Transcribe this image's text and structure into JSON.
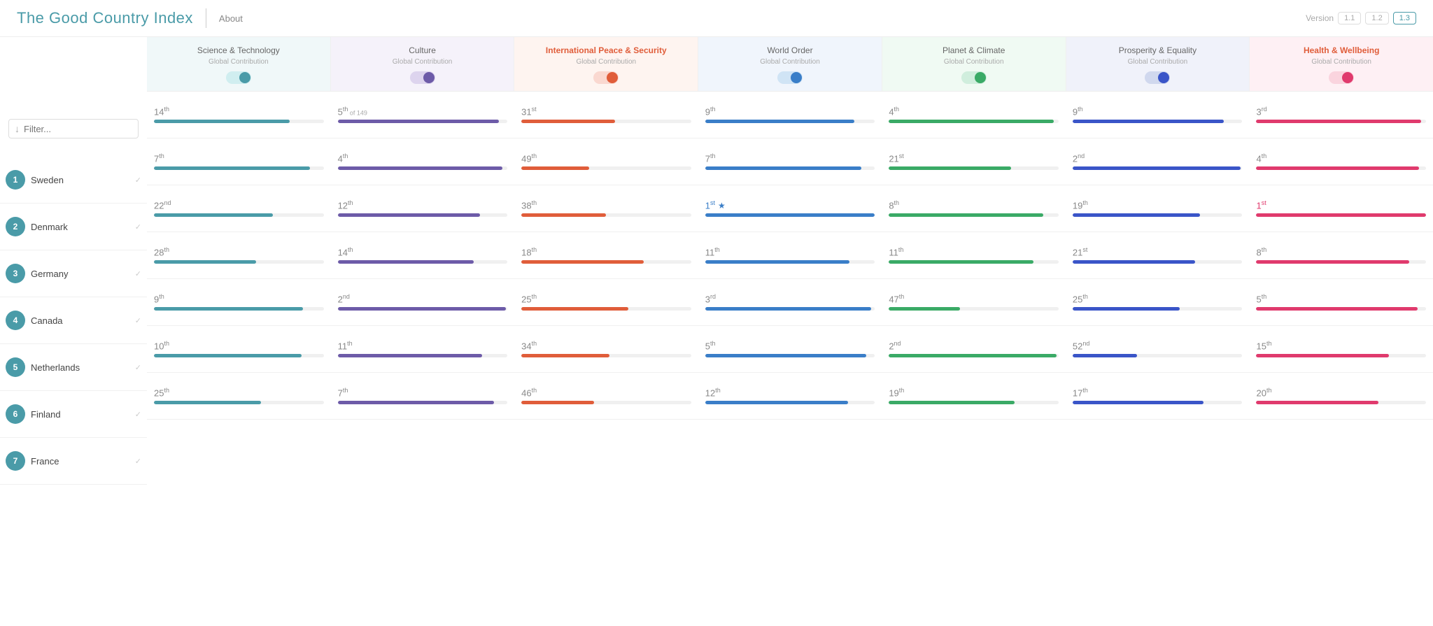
{
  "header": {
    "title": "The Good Country Index",
    "about_label": "About",
    "version_label": "Version",
    "versions": [
      "1.1",
      "1.2",
      "1.3"
    ]
  },
  "filter": {
    "placeholder": "Filter..."
  },
  "columns": [
    {
      "id": "sci_tech",
      "title": "Science & Technology",
      "subtitle": "Global Contribution",
      "highlighted": false,
      "toggle_color": "teal",
      "bg": "col-bg-teal",
      "bar_color": "bar-teal",
      "toggle_state": "on"
    },
    {
      "id": "culture",
      "title": "Culture",
      "subtitle": "Global Contribution",
      "highlighted": false,
      "toggle_color": "purple",
      "bg": "col-bg-purple",
      "bar_color": "bar-purple",
      "toggle_state": "on"
    },
    {
      "id": "int_peace",
      "title": "International Peace & Security",
      "subtitle": "Global Contribution",
      "highlighted": true,
      "toggle_color": "red",
      "bg": "col-bg-red",
      "bar_color": "bar-red",
      "toggle_state": "on"
    },
    {
      "id": "world_order",
      "title": "World Order",
      "subtitle": "Global Contribution",
      "highlighted": false,
      "toggle_color": "blue",
      "bg": "col-bg-blue",
      "bar_color": "bar-blue",
      "toggle_state": "on"
    },
    {
      "id": "planet_climate",
      "title": "Planet & Climate",
      "subtitle": "Global Contribution",
      "highlighted": false,
      "toggle_color": "green",
      "bg": "col-bg-green",
      "bar_color": "bar-green",
      "toggle_state": "on"
    },
    {
      "id": "prosperity",
      "title": "Prosperity & Equality",
      "subtitle": "Global Contribution",
      "highlighted": false,
      "toggle_color": "navy",
      "bg": "col-bg-navy",
      "bar_color": "bar-navy",
      "toggle_state": "on"
    },
    {
      "id": "health",
      "title": "Health & Wellbeing",
      "subtitle": "Global Contribution",
      "highlighted": true,
      "toggle_color": "pink",
      "bg": "col-bg-pink",
      "bar_color": "bar-pink",
      "toggle_state": "on"
    }
  ],
  "countries": [
    {
      "rank": 1,
      "name": "Sweden",
      "color": "#4a9ba8",
      "scores": [
        {
          "rank": "14",
          "suffix": "th",
          "bar": 80,
          "star": false,
          "best": false
        },
        {
          "rank": "5",
          "suffix": "th",
          "extra": "of 149",
          "bar": 95,
          "star": false,
          "best": false
        },
        {
          "rank": "31",
          "suffix": "st",
          "bar": 55,
          "star": false,
          "best": false
        },
        {
          "rank": "9",
          "suffix": "th",
          "bar": 88,
          "star": false,
          "best": false
        },
        {
          "rank": "4",
          "suffix": "th",
          "bar": 97,
          "star": false,
          "best": false
        },
        {
          "rank": "9",
          "suffix": "th",
          "bar": 89,
          "star": false,
          "best": false
        },
        {
          "rank": "3",
          "suffix": "rd",
          "bar": 97,
          "star": false,
          "best": false
        }
      ]
    },
    {
      "rank": 2,
      "name": "Denmark",
      "color": "#4a9ba8",
      "scores": [
        {
          "rank": "7",
          "suffix": "th",
          "bar": 92,
          "star": false,
          "best": false
        },
        {
          "rank": "4",
          "suffix": "th",
          "bar": 97,
          "star": false,
          "best": false
        },
        {
          "rank": "49",
          "suffix": "th",
          "bar": 40,
          "star": false,
          "best": false
        },
        {
          "rank": "7",
          "suffix": "th",
          "bar": 92,
          "star": false,
          "best": false
        },
        {
          "rank": "21",
          "suffix": "st",
          "bar": 72,
          "star": false,
          "best": false
        },
        {
          "rank": "2",
          "suffix": "nd",
          "bar": 99,
          "star": false,
          "best": false
        },
        {
          "rank": "4",
          "suffix": "th",
          "bar": 96,
          "star": false,
          "best": false
        }
      ]
    },
    {
      "rank": 3,
      "name": "Germany",
      "color": "#4a9ba8",
      "scores": [
        {
          "rank": "22",
          "suffix": "nd",
          "bar": 70,
          "star": false,
          "best": false
        },
        {
          "rank": "12",
          "suffix": "th",
          "bar": 84,
          "star": false,
          "best": false
        },
        {
          "rank": "38",
          "suffix": "th",
          "bar": 50,
          "star": false,
          "best": false
        },
        {
          "rank": "1",
          "suffix": "st",
          "bar": 100,
          "star": true,
          "best": false
        },
        {
          "rank": "8",
          "suffix": "th",
          "bar": 91,
          "star": false,
          "best": false
        },
        {
          "rank": "19",
          "suffix": "th",
          "bar": 75,
          "star": false,
          "best": false
        },
        {
          "rank": "1",
          "suffix": "st",
          "bar": 100,
          "star": false,
          "best": true
        }
      ]
    },
    {
      "rank": 4,
      "name": "Canada",
      "color": "#4a9ba8",
      "scores": [
        {
          "rank": "28",
          "suffix": "th",
          "bar": 60,
          "star": false,
          "best": false
        },
        {
          "rank": "14",
          "suffix": "th",
          "bar": 80,
          "star": false,
          "best": false
        },
        {
          "rank": "18",
          "suffix": "th",
          "bar": 72,
          "star": false,
          "best": false
        },
        {
          "rank": "11",
          "suffix": "th",
          "bar": 85,
          "star": false,
          "best": false
        },
        {
          "rank": "11",
          "suffix": "th",
          "bar": 85,
          "star": false,
          "best": false
        },
        {
          "rank": "21",
          "suffix": "st",
          "bar": 72,
          "star": false,
          "best": false
        },
        {
          "rank": "8",
          "suffix": "th",
          "bar": 90,
          "star": false,
          "best": false
        }
      ]
    },
    {
      "rank": 5,
      "name": "Netherlands",
      "color": "#4a9ba8",
      "scores": [
        {
          "rank": "9",
          "suffix": "th",
          "bar": 88,
          "star": false,
          "best": false
        },
        {
          "rank": "2",
          "suffix": "nd",
          "bar": 99,
          "star": false,
          "best": false
        },
        {
          "rank": "25",
          "suffix": "th",
          "bar": 63,
          "star": false,
          "best": false
        },
        {
          "rank": "3",
          "suffix": "rd",
          "bar": 98,
          "star": false,
          "best": false
        },
        {
          "rank": "47",
          "suffix": "th",
          "bar": 42,
          "star": false,
          "best": false
        },
        {
          "rank": "25",
          "suffix": "th",
          "bar": 63,
          "star": false,
          "best": false
        },
        {
          "rank": "5",
          "suffix": "th",
          "bar": 95,
          "star": false,
          "best": false
        }
      ]
    },
    {
      "rank": 6,
      "name": "Finland",
      "color": "#4a9ba8",
      "scores": [
        {
          "rank": "10",
          "suffix": "th",
          "bar": 87,
          "star": false,
          "best": false
        },
        {
          "rank": "11",
          "suffix": "th",
          "bar": 85,
          "star": false,
          "best": false
        },
        {
          "rank": "34",
          "suffix": "th",
          "bar": 52,
          "star": false,
          "best": false
        },
        {
          "rank": "5",
          "suffix": "th",
          "bar": 95,
          "star": false,
          "best": false
        },
        {
          "rank": "2",
          "suffix": "nd",
          "bar": 99,
          "star": false,
          "best": false
        },
        {
          "rank": "52",
          "suffix": "nd",
          "bar": 38,
          "star": false,
          "best": false
        },
        {
          "rank": "15",
          "suffix": "th",
          "bar": 78,
          "star": false,
          "best": false
        }
      ]
    },
    {
      "rank": 7,
      "name": "France",
      "color": "#4a9ba8",
      "scores": [
        {
          "rank": "25",
          "suffix": "th",
          "bar": 63,
          "star": false,
          "best": false
        },
        {
          "rank": "7",
          "suffix": "th",
          "bar": 92,
          "star": false,
          "best": false
        },
        {
          "rank": "46",
          "suffix": "th",
          "bar": 43,
          "star": false,
          "best": false
        },
        {
          "rank": "12",
          "suffix": "th",
          "bar": 84,
          "star": false,
          "best": false
        },
        {
          "rank": "19",
          "suffix": "th",
          "bar": 74,
          "star": false,
          "best": false
        },
        {
          "rank": "17",
          "suffix": "th",
          "bar": 77,
          "star": false,
          "best": false
        },
        {
          "rank": "20",
          "suffix": "th",
          "bar": 72,
          "star": false,
          "best": false
        }
      ]
    }
  ]
}
